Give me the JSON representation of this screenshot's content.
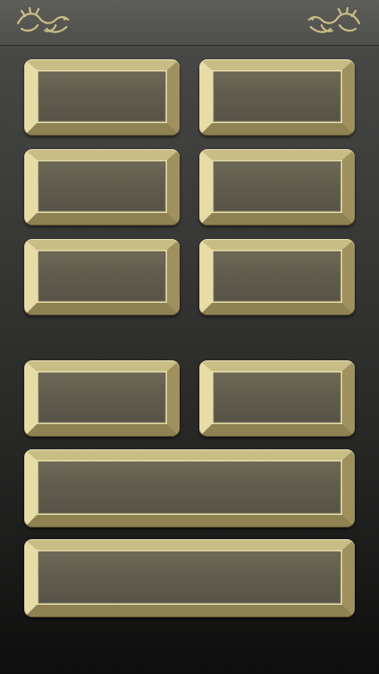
{
  "header": {
    "left_icon": "dragon-ornament-icon",
    "right_icon": "dragon-ornament-icon",
    "ornament_color": "#c8bd84"
  },
  "buttons": [
    {
      "label": ""
    },
    {
      "label": ""
    },
    {
      "label": ""
    },
    {
      "label": ""
    },
    {
      "label": ""
    },
    {
      "label": ""
    },
    {
      "label": ""
    },
    {
      "label": ""
    },
    {
      "label": ""
    },
    {
      "label": ""
    }
  ],
  "colors": {
    "gold_light": "#e6dca6",
    "gold_mid": "#c9bd86",
    "gold_dark": "#8e8152",
    "button_face": "#615d4e",
    "background_top": "#4b4b49",
    "background_bottom": "#0e0e0e"
  }
}
